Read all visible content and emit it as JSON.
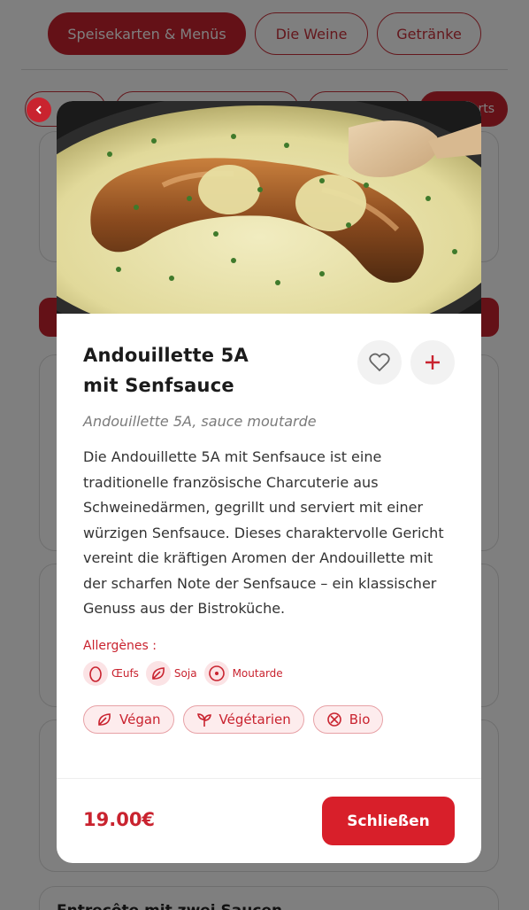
{
  "top_tabs": [
    {
      "label": "Speisekarten & Menüs",
      "active": true
    },
    {
      "label": "Die Weine",
      "active": false
    },
    {
      "label": "Getränke",
      "active": false
    }
  ],
  "sub_tabs_visible_text": "rts",
  "background_card_title": "Entrecôte mit zwei Saucen",
  "colors": {
    "brand_red": "#d81f2a",
    "tag_bg": "#fdeced"
  },
  "dish": {
    "title_line1": "Andouillette 5A",
    "title_line2": "mit Senfsauce",
    "subtitle": "Andouillette 5A, sauce moutarde",
    "description": "Die Andouillette 5A mit Senfsauce ist eine traditionelle französische Charcuterie aus Schweinedärmen, gegrillt und serviert mit einer würzigen Senfsauce. Dieses charaktervolle Gericht vereint die kräftigen Aromen der Andouillette mit der scharfen Note der Senfsauce – ein klassischer Genuss aus der Bistroküche.",
    "allergens_title": "Allergènes :",
    "allergens": [
      {
        "label": "Œufs",
        "icon": "egg-icon"
      },
      {
        "label": "Soja",
        "icon": "leaf-icon"
      },
      {
        "label": "Moutarde",
        "icon": "mustard-seed-icon"
      }
    ],
    "tags": [
      {
        "label": "Végan",
        "icon": "leaf-icon"
      },
      {
        "label": "Végétarien",
        "icon": "sprout-icon"
      },
      {
        "label": "Bio",
        "icon": "bio-icon"
      }
    ],
    "price": "19.00€",
    "close_label": "Schließen"
  }
}
